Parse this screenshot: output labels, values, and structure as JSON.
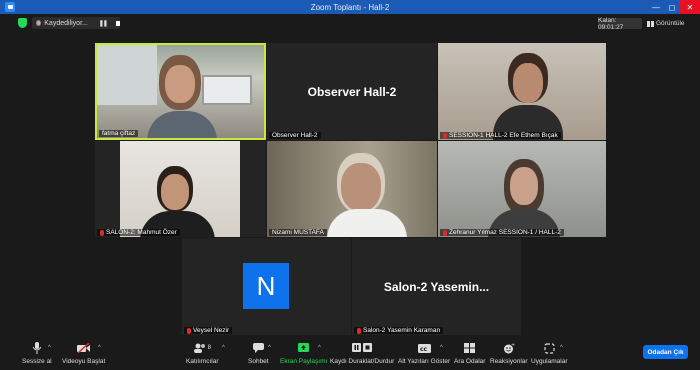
{
  "window": {
    "title": "Zoom Toplantı - Hall-2",
    "minimize_icon": "minimize-icon",
    "maximize_icon": "maximize-icon",
    "close_icon": "close-icon"
  },
  "topbar": {
    "recording_label": "Kaydediliyor...",
    "timer": "Kalan: 09:01:27",
    "view_label": "Görüntüle"
  },
  "tiles": [
    {
      "name": "fatma çiftaz",
      "muted": false,
      "kind": "video",
      "active": true
    },
    {
      "name": "Observer Hall-2",
      "muted": false,
      "kind": "text",
      "display": "Observer Hall-2"
    },
    {
      "name": "SESSION-1 HALL-2 Efe Ethem Bıçak",
      "muted": true,
      "kind": "video"
    },
    {
      "name": "SALON-2: Mahmut Özer",
      "muted": true,
      "kind": "video"
    },
    {
      "name": "Nizami MUSTAFA",
      "muted": false,
      "kind": "video"
    },
    {
      "name": "Zehranur Yılmaz SESSION-1 / HALL-2",
      "muted": true,
      "kind": "video"
    },
    {
      "name": "Veysel Nezir",
      "muted": true,
      "kind": "avatar",
      "initial": "N"
    },
    {
      "name": "Salon-2 Yasemin Karaman",
      "muted": true,
      "kind": "text",
      "display": "Salon-2  Yasemin..."
    }
  ],
  "toolbar": {
    "mute": "Sessize al",
    "video": "Videoyu Başlat",
    "participants": "Katılımcılar",
    "participants_count": "8",
    "chat": "Sohbet",
    "share": "Ekran Paylaşımı",
    "record": "Kaydı Duraklat/Durdur",
    "captions": "Alt Yazıları Göster",
    "breakout": "Ara Odalar",
    "reactions": "Reaksiyonlar",
    "apps": "Uygulamalar",
    "leave": "Odadan Çık"
  },
  "colors": {
    "accent": "#0e72ed",
    "share_green": "#23d959",
    "active_border": "#c8e83c",
    "muted_red": "#e02a2a"
  }
}
